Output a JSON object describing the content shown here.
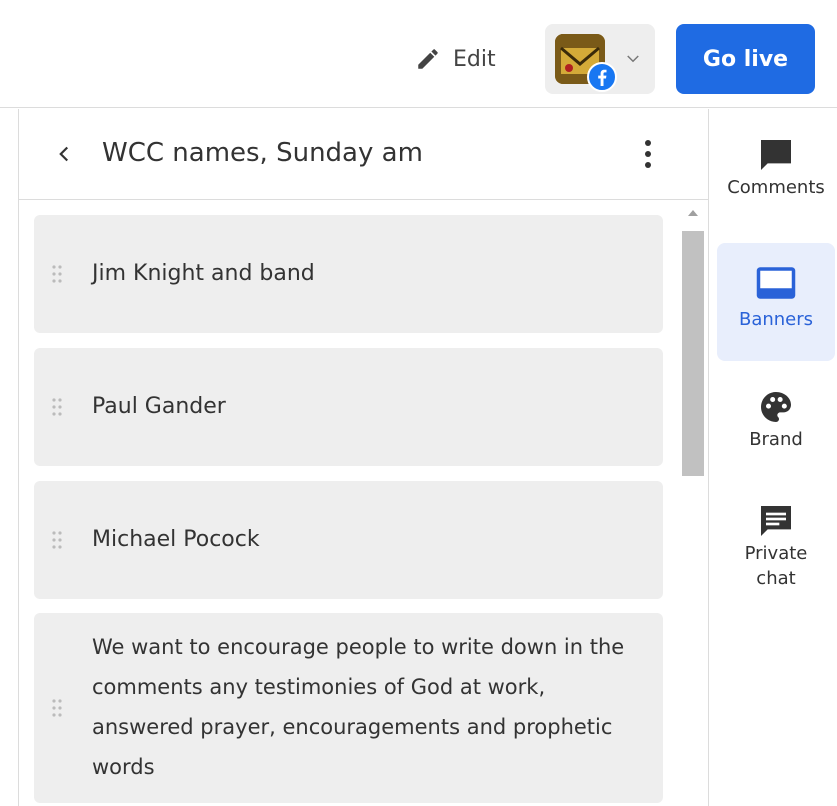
{
  "topbar": {
    "edit_label": "Edit",
    "go_live_label": "Go live"
  },
  "panel": {
    "title": "WCC names, Sunday am"
  },
  "banners": [
    {
      "text": "Jim Knight and band"
    },
    {
      "text": "Paul Gander"
    },
    {
      "text": "Michael Pocock"
    },
    {
      "text": "We want to encourage people to write down in the comments any testimonies of God at work, answered prayer, encouragements and prophetic words"
    }
  ],
  "sidebar": {
    "items": [
      {
        "label": "Comments",
        "icon": "comment-icon"
      },
      {
        "label": "Banners",
        "icon": "banner-icon",
        "active": true
      },
      {
        "label": "Brand",
        "icon": "palette-icon"
      },
      {
        "label": "Private chat",
        "icon": "chat-icon"
      }
    ]
  },
  "colors": {
    "accent": "#1f6be3",
    "active_bg": "#e8eefc",
    "active_text": "#2a62d8",
    "banner_bg": "#eeeeee",
    "facebook": "#1877f2"
  }
}
